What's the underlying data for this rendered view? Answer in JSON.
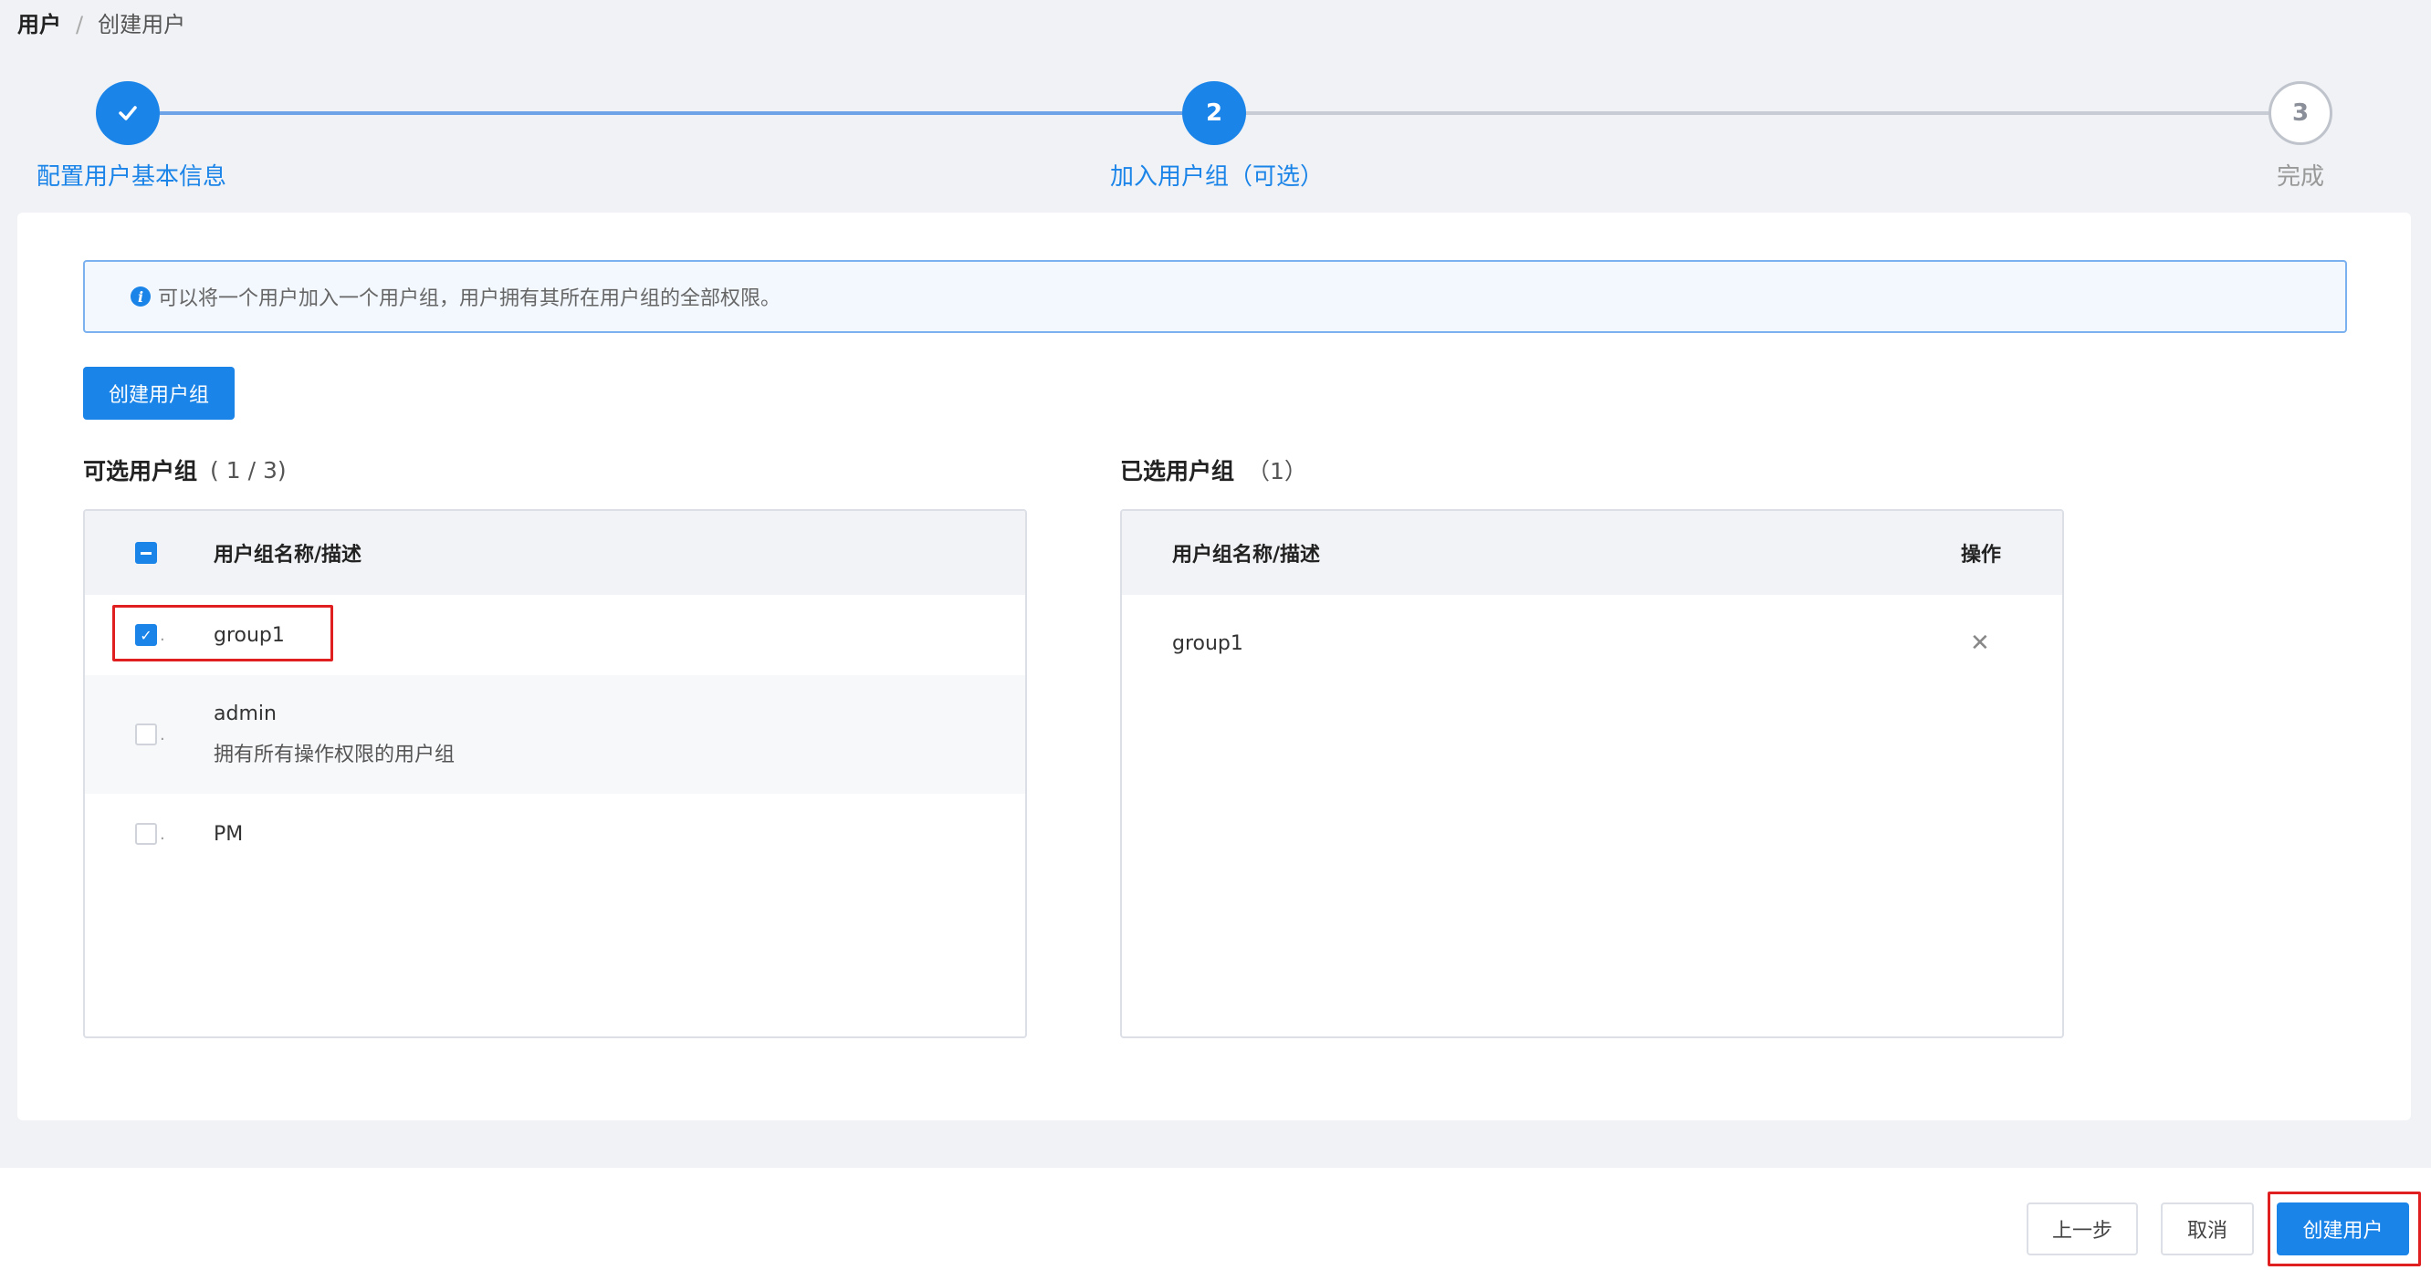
{
  "breadcrumb": {
    "root": "用户",
    "separator": "/",
    "current": "创建用户"
  },
  "steps": [
    {
      "label": "配置用户基本信息",
      "status": "done",
      "icon": "check-icon"
    },
    {
      "number": "2",
      "label": "加入用户组（可选）",
      "status": "active"
    },
    {
      "number": "3",
      "label": "完成",
      "status": "pending"
    }
  ],
  "alert": {
    "icon": "info-icon",
    "text": "可以将一个用户加入一个用户组，用户拥有其所在用户组的全部权限。"
  },
  "create_group_button": "创建用户组",
  "available": {
    "title": "可选用户组",
    "count": "( 1 / 3)",
    "header": "用户组名称/描述",
    "rows": [
      {
        "name": "group1",
        "description": "",
        "checked": true
      },
      {
        "name": "admin",
        "description": "拥有所有操作权限的用户组",
        "checked": false
      },
      {
        "name": "PM",
        "description": "",
        "checked": false
      }
    ]
  },
  "selected": {
    "title": "已选用户组",
    "count": "（1）",
    "header_name": "用户组名称/描述",
    "header_action": "操作",
    "rows": [
      {
        "name": "group1",
        "remove_icon": "close-icon"
      }
    ]
  },
  "footer": {
    "prev_button": "上一步",
    "cancel_button": "取消",
    "create_button": "创建用户"
  },
  "colors": {
    "primary": "#1b84e8",
    "highlight": "#e02020",
    "background": "#f0f2f5"
  }
}
